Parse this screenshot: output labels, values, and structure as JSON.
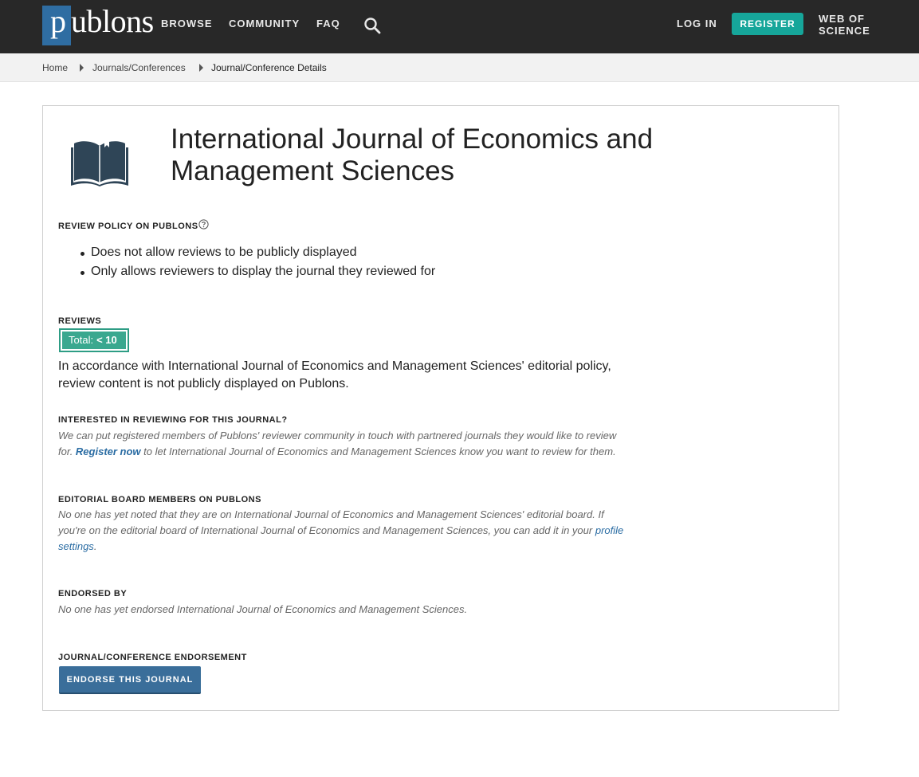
{
  "nav": {
    "logo_p": "p",
    "logo_rest": "ublons",
    "browse": "BROWSE",
    "community": "COMMUNITY",
    "faq": "FAQ",
    "login": "LOG IN",
    "register": "REGISTER",
    "wos_line1": "WEB OF",
    "wos_line2": "SCIENCE"
  },
  "breadcrumb": {
    "home": "Home",
    "journals": "Journals/Conferences",
    "current": "Journal/Conference Details"
  },
  "journal": {
    "title": "International Journal of Economics and Management Sciences"
  },
  "review_policy": {
    "label": "REVIEW POLICY ON PUBLONS",
    "items": [
      "Does not allow reviews to be publicly displayed",
      "Only allows reviewers to display the journal they reviewed for"
    ]
  },
  "reviews": {
    "label": "REVIEWS",
    "total_label": "Total:",
    "total_value": "< 10",
    "note": "In accordance with International Journal of Economics and Management Sciences' editorial policy, review content is not publicly displayed on Publons."
  },
  "interested": {
    "label": "INTERESTED IN REVIEWING FOR THIS JOURNAL?",
    "text_before": "We can put registered members of Publons' reviewer community in touch with partnered journals they would like to review for. ",
    "link": "Register now",
    "text_after": " to let International Journal of Economics and Management Sciences know you want to review for them."
  },
  "editorial": {
    "label": "EDITORIAL BOARD MEMBERS ON PUBLONS",
    "text_before": "No one has yet noted that they are on International Journal of Economics and Management Sciences' editorial board. If you're on the editorial board of International Journal of Economics and Management Sciences, you can add it in your ",
    "link": "profile settings",
    "text_after": "."
  },
  "endorsed": {
    "label": "ENDORSED BY",
    "text": "No one has yet endorsed International Journal of Economics and Management Sciences."
  },
  "endorsement": {
    "label": "JOURNAL/CONFERENCE ENDORSEMENT",
    "button": "ENDORSE THIS JOURNAL"
  },
  "colors": {
    "navbar": "#282828",
    "logo_block": "#2f6da2",
    "register": "#16a69a",
    "badge": "#3aa88f",
    "link": "#2a6ca3",
    "endorse_button": "#3a6e9a"
  },
  "icons": [
    "search-icon",
    "chevron-right-icon",
    "book-icon",
    "help-icon"
  ]
}
